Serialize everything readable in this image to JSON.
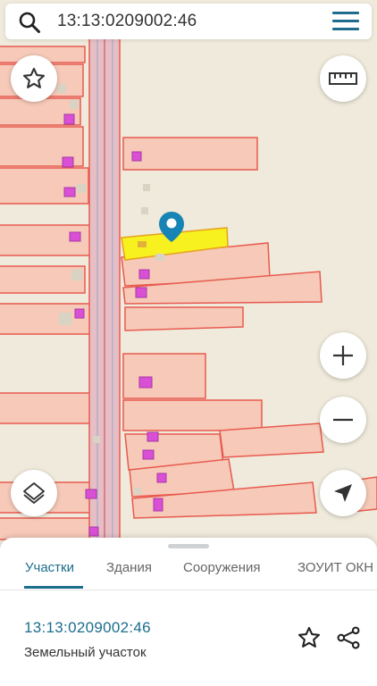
{
  "search": {
    "value": "13:13:0209002:46",
    "icon": "search-icon"
  },
  "map": {
    "icons": {
      "favorite": "star-icon",
      "ruler": "ruler-icon",
      "zoom_in": "plus-icon",
      "zoom_out": "minus-icon",
      "layers": "layers-icon",
      "locate": "navigation-arrow-icon",
      "marker": "map-pin-icon"
    },
    "colors": {
      "background": "#efeadb",
      "parcel_fill": "#f6c9b8",
      "parcel_stroke": "#e85a4f",
      "building_fill": "#d94fd6",
      "selected_parcel": "#f7f21f",
      "road_fill": "#e6bfc6",
      "pin": "#1784b5"
    }
  },
  "sheet": {
    "tabs": [
      {
        "label": "Участки",
        "active": true
      },
      {
        "label": "Здания",
        "active": false
      },
      {
        "label": "Сооружения",
        "active": false
      },
      {
        "label": "ЗОУИТ ОКН",
        "active": false
      }
    ],
    "parcel": {
      "id": "13:13:0209002:46",
      "type": "Земельный участок"
    },
    "accent": "#1b6d8c"
  }
}
